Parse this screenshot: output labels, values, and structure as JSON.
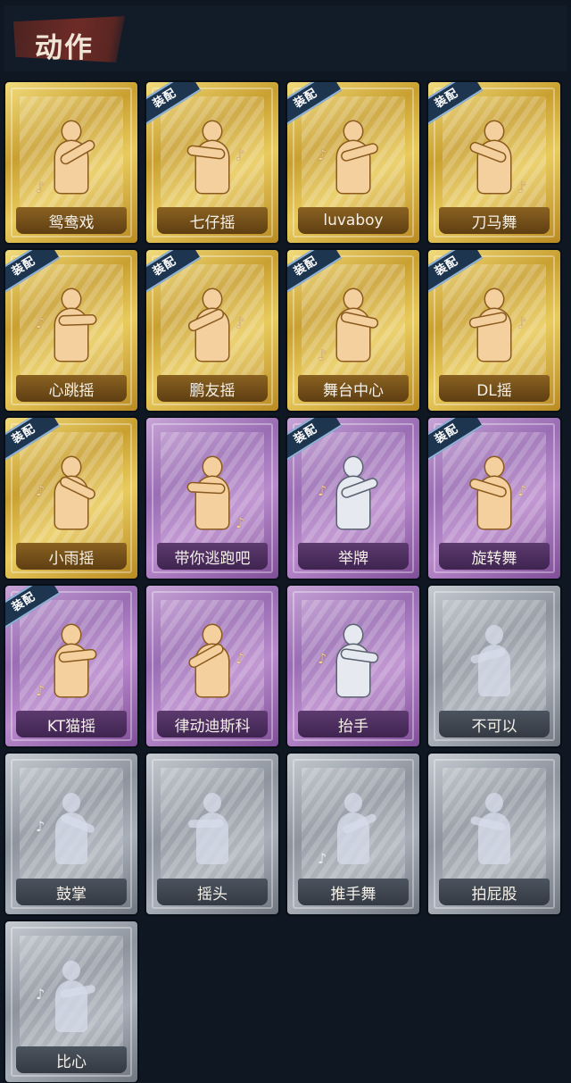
{
  "header": {
    "title": "动作"
  },
  "badge_text": "装配",
  "cards": [
    {
      "label": "鸳鸯戏",
      "equipped": false,
      "rarity": "gold"
    },
    {
      "label": "七仔摇",
      "equipped": true,
      "rarity": "gold"
    },
    {
      "label": "luvaboy",
      "equipped": true,
      "rarity": "gold"
    },
    {
      "label": "刀马舞",
      "equipped": true,
      "rarity": "gold"
    },
    {
      "label": "心跳摇",
      "equipped": true,
      "rarity": "gold"
    },
    {
      "label": "鹏友摇",
      "equipped": true,
      "rarity": "gold"
    },
    {
      "label": "舞台中心",
      "equipped": true,
      "rarity": "gold"
    },
    {
      "label": "DL摇",
      "equipped": true,
      "rarity": "gold"
    },
    {
      "label": "小雨摇",
      "equipped": true,
      "rarity": "gold"
    },
    {
      "label": "带你逃跑吧",
      "equipped": false,
      "rarity": "purple"
    },
    {
      "label": "举牌",
      "equipped": true,
      "rarity": "purple"
    },
    {
      "label": "旋转舞",
      "equipped": true,
      "rarity": "purple"
    },
    {
      "label": "KT猫摇",
      "equipped": true,
      "rarity": "purple"
    },
    {
      "label": "律动迪斯科",
      "equipped": false,
      "rarity": "purple"
    },
    {
      "label": "抬手",
      "equipped": false,
      "rarity": "purple"
    },
    {
      "label": "不可以",
      "equipped": false,
      "rarity": "grey"
    },
    {
      "label": "鼓掌",
      "equipped": false,
      "rarity": "grey"
    },
    {
      "label": "摇头",
      "equipped": false,
      "rarity": "grey"
    },
    {
      "label": "推手舞",
      "equipped": false,
      "rarity": "grey"
    },
    {
      "label": "拍屁股",
      "equipped": false,
      "rarity": "grey"
    },
    {
      "label": "比心",
      "equipped": false,
      "rarity": "grey"
    }
  ]
}
